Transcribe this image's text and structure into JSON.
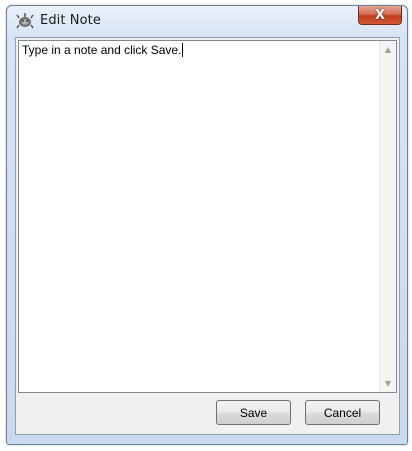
{
  "window": {
    "title": "Edit Note",
    "close_glyph": "X"
  },
  "note": {
    "value": "Type in a note and click Save."
  },
  "buttons": {
    "save_label": "Save",
    "cancel_label": "Cancel"
  },
  "icons": {
    "app": "note-app-icon",
    "close": "close-icon",
    "scroll_up": "scroll-up-arrow-icon",
    "scroll_down": "scroll-down-arrow-icon"
  },
  "colors": {
    "title_bar": "#d7e4f3",
    "close_button": "#c3391c",
    "client_background": "#f0f0f0"
  }
}
